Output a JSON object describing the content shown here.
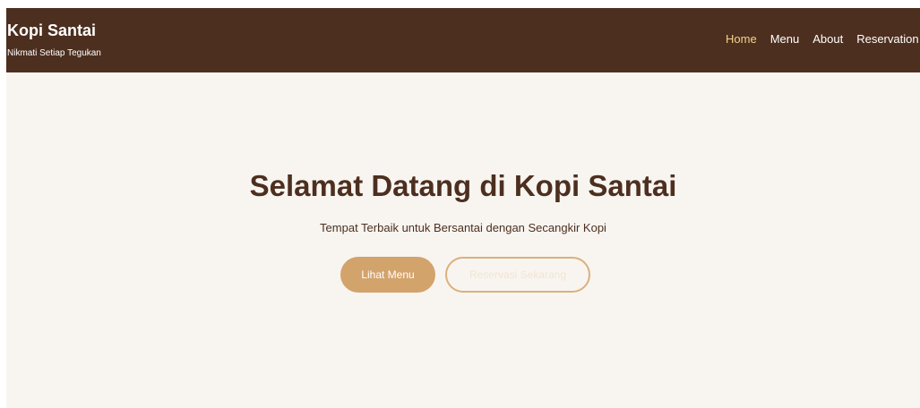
{
  "colors": {
    "navbar_bg": "#4d2f1f",
    "page_bg": "#f8f5f1",
    "accent": "#d3a36c",
    "active_link": "#f2d38c",
    "title_text": "#4d2f1f"
  },
  "header": {
    "brand_title": "Kopi Santai",
    "brand_tagline": "Nikmati Setiap Tegukan"
  },
  "nav": {
    "items": [
      {
        "label": "Home",
        "active": true
      },
      {
        "label": "Menu",
        "active": false
      },
      {
        "label": "About",
        "active": false
      },
      {
        "label": "Reservation",
        "active": false
      }
    ]
  },
  "hero": {
    "title": "Selamat Datang di Kopi Santai",
    "subtitle": "Tempat Terbaik untuk Bersantai dengan Secangkir Kopi",
    "primary_button": "Lihat Menu",
    "secondary_button": "Reservasi Sekarang"
  }
}
